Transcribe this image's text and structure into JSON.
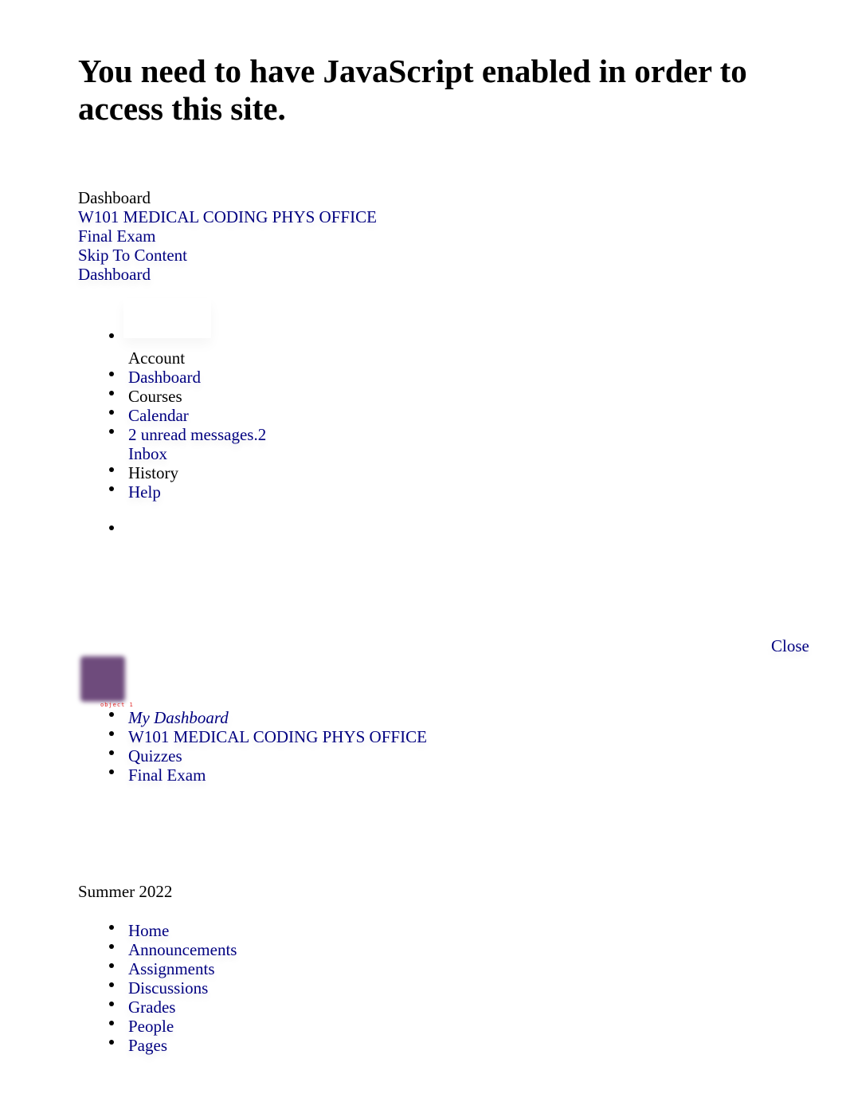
{
  "noscript_message": "You need to have JavaScript enabled in order to access this site.",
  "header_crumbs": {
    "title": "Dashboard",
    "course_link": "W101 MEDICAL CODING PHYS OFFICE",
    "page_link": "Final Exam",
    "skip_link": "Skip To Content",
    "dashboard_link": "Dashboard"
  },
  "global_nav": {
    "items": [
      {
        "label": "Account",
        "link": false
      },
      {
        "label": "Dashboard",
        "link": true
      },
      {
        "label": "Courses",
        "link": false
      },
      {
        "label": "Calendar",
        "link": true
      },
      {
        "label": "2 unread messages.2",
        "sublabel": "Inbox",
        "link": true
      },
      {
        "label": "History",
        "link": false
      },
      {
        "label": "Help",
        "link": true
      }
    ]
  },
  "close_label": "Close",
  "avatar": {
    "color": "#6e4b7c",
    "overlay_label": "object 1"
  },
  "course_breadcrumbs": [
    {
      "label": "My Dashboard",
      "italic": true
    },
    {
      "label": "W101 MEDICAL CODING PHYS OFFICE"
    },
    {
      "label": "Quizzes"
    },
    {
      "label": "Final Exam"
    }
  ],
  "term": "Summer 2022",
  "course_nav": [
    {
      "label": "Home"
    },
    {
      "label": "Announcements"
    },
    {
      "label": "Assignments"
    },
    {
      "label": "Discussions"
    },
    {
      "label": "Grades"
    },
    {
      "label": "People"
    },
    {
      "label": "Pages"
    }
  ],
  "colors": {
    "link": "#000080",
    "text": "#000000",
    "object_label": "#e02020"
  }
}
